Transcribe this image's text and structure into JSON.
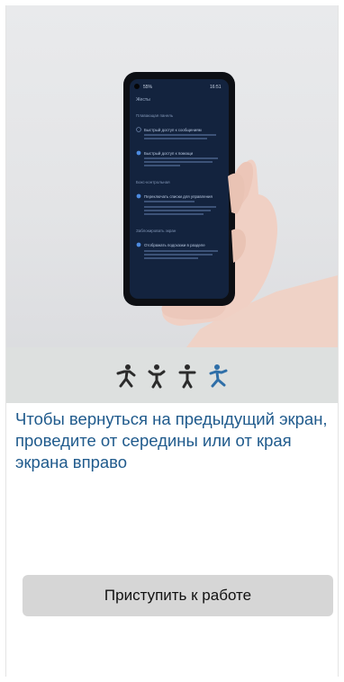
{
  "phone_screen": {
    "status_left": "55%",
    "status_right": "16:51",
    "title": "Жесты",
    "section1": "Плавающая панель",
    "option1_title": "Быстрый доступ к сообщениям",
    "option2_title": "Быстрый доступ к помощи",
    "section2": "Бокс-контрольная",
    "option3_title": "Переключать списки для управления",
    "section3": "Заблокировать экран",
    "option4_title": "Отображать подсказки в разделе"
  },
  "step_icons": [
    "walking-figure-icon",
    "standing-figure-icon",
    "standing-figure-icon",
    "walking-figure-icon-active"
  ],
  "instruction": "Чтобы вернуться на предыдущий экран, проведите от середины или от края экрана вправо",
  "button_label": "Приступить к работе",
  "colors": {
    "instruction_text": "#1f5a8c",
    "active_step": "#2f6fa8",
    "inactive_step": "#2b2b2b",
    "button_bg": "#d6d6d6",
    "band_bg": "#dde0df"
  }
}
